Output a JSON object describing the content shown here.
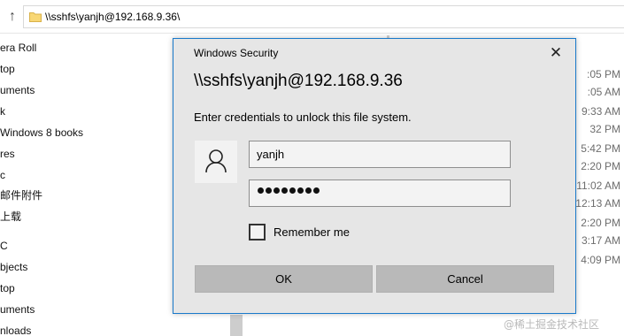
{
  "explorer": {
    "address_path": "\\\\sshfs\\yanjh@192.168.9.36\\",
    "nav_items": [
      "era Roll",
      "top",
      "uments",
      "k",
      "Windows 8 books",
      "res",
      "c",
      "邮件附件",
      "上载",
      "C",
      "bjects",
      "top",
      "uments",
      "nloads"
    ],
    "modified_times": [
      ":05 PM",
      ":05 AM",
      "9:33 AM",
      "32 PM",
      "5:42 PM",
      "2:20 PM",
      "11:02 AM",
      "12:13 AM",
      "2:20 PM",
      "3:17 AM",
      "4:09 PM"
    ]
  },
  "dialog": {
    "title": "Windows Security",
    "close_glyph": "✕",
    "heading": "\\\\sshfs\\yanjh@192.168.9.36",
    "prompt": "Enter credentials to unlock this file system.",
    "username_value": "yanjh",
    "password_length": 8,
    "remember_label": "Remember me",
    "remember_checked": false,
    "ok_label": "OK",
    "cancel_label": "Cancel",
    "avatar_icon": "user-icon"
  },
  "watermark": "@稀土掘金技术社区",
  "colors": {
    "dialog_border": "#1979ca",
    "dialog_bg": "#e6e6e6",
    "button_bg": "#b9b9b9",
    "folder_yellow": "#f8d775"
  }
}
